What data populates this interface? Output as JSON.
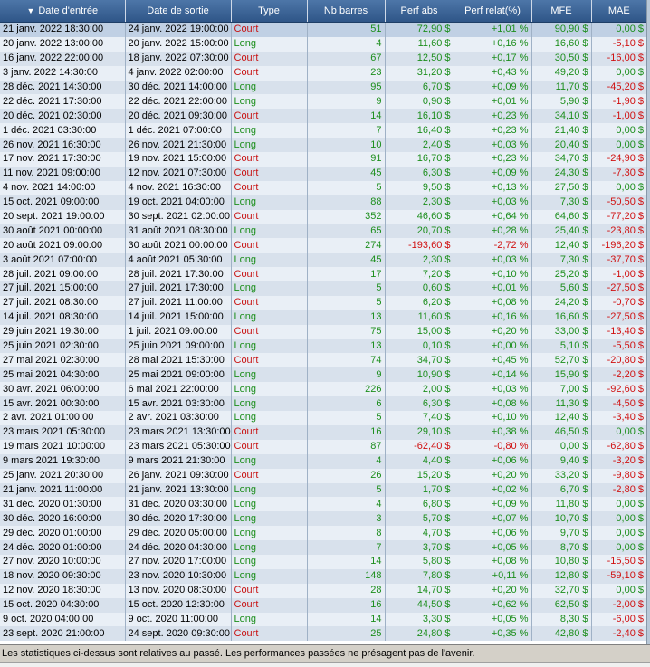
{
  "columns": [
    {
      "key": "entry",
      "label": "Date d'entrée",
      "sorted": true
    },
    {
      "key": "exit",
      "label": "Date de sortie"
    },
    {
      "key": "type",
      "label": "Type"
    },
    {
      "key": "bars",
      "label": "Nb barres"
    },
    {
      "key": "abs",
      "label": "Perf abs"
    },
    {
      "key": "rel",
      "label": "Perf relat(%)"
    },
    {
      "key": "mfe",
      "label": "MFE"
    },
    {
      "key": "mae",
      "label": "MAE"
    }
  ],
  "rows": [
    [
      "21 janv. 2022 18:30:00",
      "24 janv. 2022 19:00:00",
      "Court",
      "51",
      "72,90 $",
      "+1,01 %",
      "90,90 $",
      "0,00 $"
    ],
    [
      "20 janv. 2022 13:00:00",
      "20 janv. 2022 15:00:00",
      "Long",
      "4",
      "11,60 $",
      "+0,16 %",
      "16,60 $",
      "-5,10 $"
    ],
    [
      "16 janv. 2022 22:00:00",
      "18 janv. 2022 07:30:00",
      "Court",
      "67",
      "12,50 $",
      "+0,17 %",
      "30,50 $",
      "-16,00 $"
    ],
    [
      "3 janv. 2022 14:30:00",
      "4 janv. 2022 02:00:00",
      "Court",
      "23",
      "31,20 $",
      "+0,43 %",
      "49,20 $",
      "0,00 $"
    ],
    [
      "28 déc. 2021 14:30:00",
      "30 déc. 2021 14:00:00",
      "Long",
      "95",
      "6,70 $",
      "+0,09 %",
      "11,70 $",
      "-45,20 $"
    ],
    [
      "22 déc. 2021 17:30:00",
      "22 déc. 2021 22:00:00",
      "Long",
      "9",
      "0,90 $",
      "+0,01 %",
      "5,90 $",
      "-1,90 $"
    ],
    [
      "20 déc. 2021 02:30:00",
      "20 déc. 2021 09:30:00",
      "Court",
      "14",
      "16,10 $",
      "+0,23 %",
      "34,10 $",
      "-1,00 $"
    ],
    [
      "1 déc. 2021 03:30:00",
      "1 déc. 2021 07:00:00",
      "Long",
      "7",
      "16,40 $",
      "+0,23 %",
      "21,40 $",
      "0,00 $"
    ],
    [
      "26 nov. 2021 16:30:00",
      "26 nov. 2021 21:30:00",
      "Long",
      "10",
      "2,40 $",
      "+0,03 %",
      "20,40 $",
      "0,00 $"
    ],
    [
      "17 nov. 2021 17:30:00",
      "19 nov. 2021 15:00:00",
      "Court",
      "91",
      "16,70 $",
      "+0,23 %",
      "34,70 $",
      "-24,90 $"
    ],
    [
      "11 nov. 2021 09:00:00",
      "12 nov. 2021 07:30:00",
      "Court",
      "45",
      "6,30 $",
      "+0,09 %",
      "24,30 $",
      "-7,30 $"
    ],
    [
      "4 nov. 2021 14:00:00",
      "4 nov. 2021 16:30:00",
      "Court",
      "5",
      "9,50 $",
      "+0,13 %",
      "27,50 $",
      "0,00 $"
    ],
    [
      "15 oct. 2021 09:00:00",
      "19 oct. 2021 04:00:00",
      "Long",
      "88",
      "2,30 $",
      "+0,03 %",
      "7,30 $",
      "-50,50 $"
    ],
    [
      "20 sept. 2021 19:00:00",
      "30 sept. 2021 02:00:00",
      "Court",
      "352",
      "46,60 $",
      "+0,64 %",
      "64,60 $",
      "-77,20 $"
    ],
    [
      "30 août 2021 00:00:00",
      "31 août 2021 08:30:00",
      "Long",
      "65",
      "20,70 $",
      "+0,28 %",
      "25,40 $",
      "-23,80 $"
    ],
    [
      "20 août 2021 09:00:00",
      "30 août 2021 00:00:00",
      "Court",
      "274",
      "-193,60 $",
      "-2,72 %",
      "12,40 $",
      "-196,20 $"
    ],
    [
      "3 août 2021 07:00:00",
      "4 août 2021 05:30:00",
      "Long",
      "45",
      "2,30 $",
      "+0,03 %",
      "7,30 $",
      "-37,70 $"
    ],
    [
      "28 juil. 2021 09:00:00",
      "28 juil. 2021 17:30:00",
      "Court",
      "17",
      "7,20 $",
      "+0,10 %",
      "25,20 $",
      "-1,00 $"
    ],
    [
      "27 juil. 2021 15:00:00",
      "27 juil. 2021 17:30:00",
      "Long",
      "5",
      "0,60 $",
      "+0,01 %",
      "5,60 $",
      "-27,50 $"
    ],
    [
      "27 juil. 2021 08:30:00",
      "27 juil. 2021 11:00:00",
      "Court",
      "5",
      "6,20 $",
      "+0,08 %",
      "24,20 $",
      "-0,70 $"
    ],
    [
      "14 juil. 2021 08:30:00",
      "14 juil. 2021 15:00:00",
      "Long",
      "13",
      "11,60 $",
      "+0,16 %",
      "16,60 $",
      "-27,50 $"
    ],
    [
      "29 juin 2021 19:30:00",
      "1 juil. 2021 09:00:00",
      "Court",
      "75",
      "15,00 $",
      "+0,20 %",
      "33,00 $",
      "-13,40 $"
    ],
    [
      "25 juin 2021 02:30:00",
      "25 juin 2021 09:00:00",
      "Long",
      "13",
      "0,10 $",
      "+0,00 %",
      "5,10 $",
      "-5,50 $"
    ],
    [
      "27 mai 2021 02:30:00",
      "28 mai 2021 15:30:00",
      "Court",
      "74",
      "34,70 $",
      "+0,45 %",
      "52,70 $",
      "-20,80 $"
    ],
    [
      "25 mai 2021 04:30:00",
      "25 mai 2021 09:00:00",
      "Long",
      "9",
      "10,90 $",
      "+0,14 %",
      "15,90 $",
      "-2,20 $"
    ],
    [
      "30 avr. 2021 06:00:00",
      "6 mai 2021 22:00:00",
      "Long",
      "226",
      "2,00 $",
      "+0,03 %",
      "7,00 $",
      "-92,60 $"
    ],
    [
      "15 avr. 2021 00:30:00",
      "15 avr. 2021 03:30:00",
      "Long",
      "6",
      "6,30 $",
      "+0,08 %",
      "11,30 $",
      "-4,50 $"
    ],
    [
      "2 avr. 2021 01:00:00",
      "2 avr. 2021 03:30:00",
      "Long",
      "5",
      "7,40 $",
      "+0,10 %",
      "12,40 $",
      "-3,40 $"
    ],
    [
      "23 mars 2021 05:30:00",
      "23 mars 2021 13:30:00",
      "Court",
      "16",
      "29,10 $",
      "+0,38 %",
      "46,50 $",
      "0,00 $"
    ],
    [
      "19 mars 2021 10:00:00",
      "23 mars 2021 05:30:00",
      "Court",
      "87",
      "-62,40 $",
      "-0,80 %",
      "0,00 $",
      "-62,80 $"
    ],
    [
      "9 mars 2021 19:30:00",
      "9 mars 2021 21:30:00",
      "Long",
      "4",
      "4,40 $",
      "+0,06 %",
      "9,40 $",
      "-3,20 $"
    ],
    [
      "25 janv. 2021 20:30:00",
      "26 janv. 2021 09:30:00",
      "Court",
      "26",
      "15,20 $",
      "+0,20 %",
      "33,20 $",
      "-9,80 $"
    ],
    [
      "21 janv. 2021 11:00:00",
      "21 janv. 2021 13:30:00",
      "Long",
      "5",
      "1,70 $",
      "+0,02 %",
      "6,70 $",
      "-2,80 $"
    ],
    [
      "31 déc. 2020 01:30:00",
      "31 déc. 2020 03:30:00",
      "Long",
      "4",
      "6,80 $",
      "+0,09 %",
      "11,80 $",
      "0,00 $"
    ],
    [
      "30 déc. 2020 16:00:00",
      "30 déc. 2020 17:30:00",
      "Long",
      "3",
      "5,70 $",
      "+0,07 %",
      "10,70 $",
      "0,00 $"
    ],
    [
      "29 déc. 2020 01:00:00",
      "29 déc. 2020 05:00:00",
      "Long",
      "8",
      "4,70 $",
      "+0,06 %",
      "9,70 $",
      "0,00 $"
    ],
    [
      "24 déc. 2020 01:00:00",
      "24 déc. 2020 04:30:00",
      "Long",
      "7",
      "3,70 $",
      "+0,05 %",
      "8,70 $",
      "0,00 $"
    ],
    [
      "27 nov. 2020 10:00:00",
      "27 nov. 2020 17:00:00",
      "Long",
      "14",
      "5,80 $",
      "+0,08 %",
      "10,80 $",
      "-15,50 $"
    ],
    [
      "18 nov. 2020 09:30:00",
      "23 nov. 2020 10:30:00",
      "Long",
      "148",
      "7,80 $",
      "+0,11 %",
      "12,80 $",
      "-59,10 $"
    ],
    [
      "12 nov. 2020 18:30:00",
      "13 nov. 2020 08:30:00",
      "Court",
      "28",
      "14,70 $",
      "+0,20 %",
      "32,70 $",
      "0,00 $"
    ],
    [
      "15 oct. 2020 04:30:00",
      "15 oct. 2020 12:30:00",
      "Court",
      "16",
      "44,50 $",
      "+0,62 %",
      "62,50 $",
      "-2,00 $"
    ],
    [
      "9 oct. 2020 04:00:00",
      "9 oct. 2020 11:00:00",
      "Long",
      "14",
      "3,30 $",
      "+0,05 %",
      "8,30 $",
      "-6,00 $"
    ],
    [
      "23 sept. 2020 21:00:00",
      "24 sept. 2020 09:30:00",
      "Court",
      "25",
      "24,80 $",
      "+0,35 %",
      "42,80 $",
      "-2,40 $"
    ]
  ],
  "disclaimer": "Les statistiques ci-dessus sont relatives au passé. Les performances passées ne présagent pas de l'avenir.",
  "colors": {
    "court": "#c81414",
    "long": "#1c8e1c",
    "negative": "#d01010",
    "header": "#3a62a0"
  },
  "icons": {
    "sort": "sort-desc-icon"
  }
}
